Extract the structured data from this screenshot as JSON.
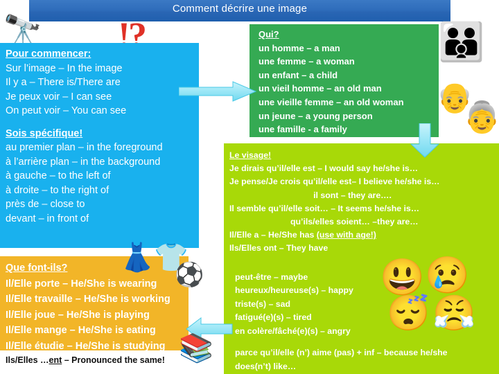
{
  "slide": {
    "title": "Comment décrire une image",
    "colors": {
      "title_bar": "#2f6dbb",
      "blue_box": "#19b1ee",
      "green_box": "#35aa53",
      "lime_box": "#a8d908",
      "orange_box": "#f2b528",
      "arrow": "#9fe8f7",
      "text": "#ffffff"
    }
  },
  "blue_box": {
    "heading1": "Pour commencer:",
    "lines1": [
      "Sur l’image – In the image",
      "Il y a – There is/There are",
      "Je peux voir – I can see",
      "On peut voir – You can see"
    ],
    "heading2": "Sois spécifique!",
    "lines2": [
      "au premier plan – in the foreground",
      "à l’arrière plan – in the background",
      "à gauche – to the left of",
      "à droite  – to the right of",
      "près de – close to",
      "devant – in front of"
    ]
  },
  "green_box": {
    "heading": "Qui?",
    "lines": [
      "un homme – a man",
      "une femme – a woman",
      "un enfant – a child",
      "un vieil homme – an old man",
      "une vieille femme – an old woman",
      "un jeune – a young person",
      "une famille -  a family"
    ]
  },
  "lime_box": {
    "heading": "Le visage!",
    "lines": [
      "Je dirais qu’il/elle est – I would say he/she is…",
      "Je pense/Je crois qu’il/elle est– I believe he/she is…",
      "il sont – they are….",
      "Il semble qu’il/elle soit… – It seems he/she is…",
      "qu’ils/elles soient… –they are…",
      "Il/Elle a – He/She has",
      "Ils/Elles ont – They have"
    ],
    "line6_underlined": "(use with age!)",
    "lines2": [
      "peut-être – maybe",
      "heureux/heureuse(s) – happy",
      "triste(s) – sad",
      "fatigué(e)(s) – tired",
      "en colère/fâché(e)(s) – angry"
    ],
    "closing_line1": "parce qu’il/elle (n’) aime (pas) + inf – because he/she",
    "closing_line2": "does(n’t) like…"
  },
  "orange_box": {
    "heading": "Que font-ils?",
    "lines": [
      "Il/Elle porte – He/She is wearing",
      "Il/Elle travaille – He/She is working",
      "Il/Elle joue – He/She is playing",
      "Il/Elle mange – He/She is eating",
      "Il/Elle étudie – He/She is studying"
    ],
    "footnote_prefix": "Ils/Elles …",
    "footnote_underlined": "ent",
    "footnote_suffix": " – Pronounced the same!"
  },
  "decorations": {
    "binoculars": "🔭",
    "punctuation": "!?",
    "family": "👪",
    "old_man": "👴",
    "old_woman": "👵",
    "dress": "👗",
    "shirt": "👕",
    "soccer_ball": "⚽",
    "books": "📚",
    "grinning_face": "😃",
    "crying_face": "😢",
    "sleeping_face": "😴",
    "angry_face": "😤"
  }
}
